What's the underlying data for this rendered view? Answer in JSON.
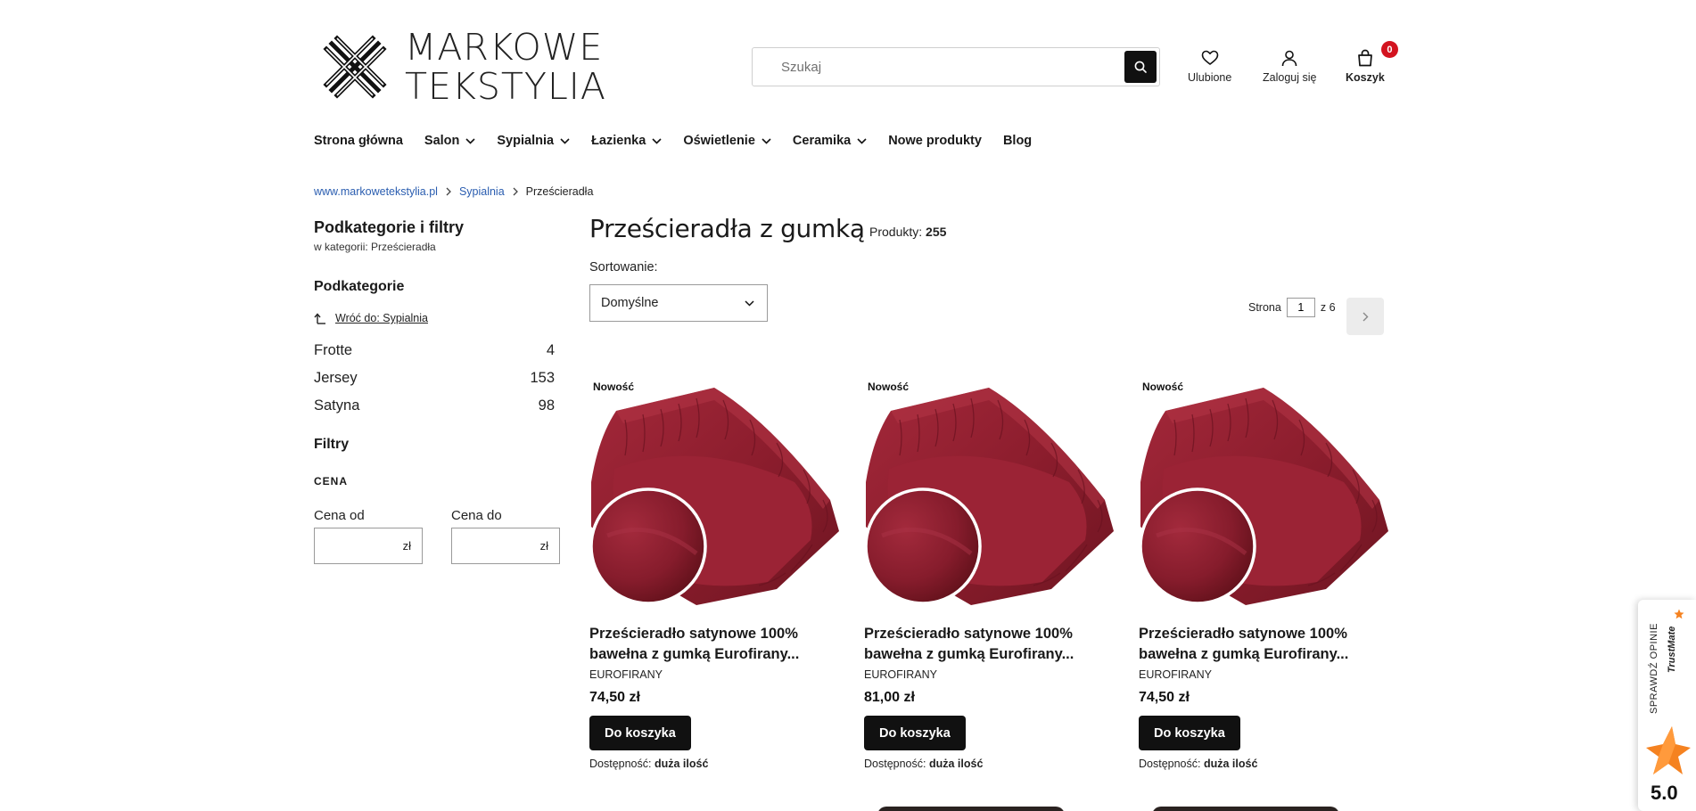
{
  "header": {
    "logo_line1": "MARKOWE",
    "logo_line2": "TEKSTYLIA",
    "search_placeholder": "Szukaj",
    "favorites_label": "Ulubione",
    "login_label": "Zaloguj się",
    "cart_label": "Koszyk",
    "cart_count": "0",
    "accent_color": "#d3131f"
  },
  "nav": {
    "items": [
      {
        "label": "Strona główna",
        "has_dropdown": false
      },
      {
        "label": "Salon",
        "has_dropdown": true
      },
      {
        "label": "Sypialnia",
        "has_dropdown": true
      },
      {
        "label": "Łazienka",
        "has_dropdown": true
      },
      {
        "label": "Oświetlenie",
        "has_dropdown": true
      },
      {
        "label": "Ceramika",
        "has_dropdown": true
      },
      {
        "label": "Nowe produkty",
        "has_dropdown": false
      },
      {
        "label": "Blog",
        "has_dropdown": false
      }
    ]
  },
  "breadcrumb": {
    "home": "www.markowetekstylia.pl",
    "parent": "Sypialnia",
    "current": "Prześcieradła"
  },
  "sidebar": {
    "title": "Podkategorie i filtry",
    "subtitle": "w kategorii: Prześcieradła",
    "subcategories_heading": "Podkategorie",
    "back_link": "Wróć do: Sypialnia",
    "categories": [
      {
        "name": "Frotte",
        "count": "4"
      },
      {
        "name": "Jersey",
        "count": "153"
      },
      {
        "name": "Satyna",
        "count": "98"
      }
    ],
    "filters_heading": "Filtry",
    "price_heading": "CENA",
    "price_from_label": "Cena od",
    "price_to_label": "Cena do",
    "currency": "zł"
  },
  "main": {
    "title": "Prześcieradła z gumką",
    "count_label": "Produkty:",
    "count_value": "255",
    "sort_label": "Sortowanie:",
    "sort_value": "Domyślne",
    "pager_label": "Strona",
    "pager_current": "1",
    "pager_of": "z 6"
  },
  "products": [
    {
      "badge": "Nowość",
      "name_line1": "Prześcieradło satynowe 100%",
      "name_line2": "bawełna z gumką Eurofirany...",
      "brand": "EUROFIRANY",
      "price": "74,50 zł",
      "button": "Do koszyka",
      "availability_label": "Dostępność:",
      "availability_value": "duża ilość",
      "color": "#8e1f2c"
    },
    {
      "badge": "Nowość",
      "name_line1": "Prześcieradło satynowe 100%",
      "name_line2": "bawełna z gumką Eurofirany...",
      "brand": "EUROFIRANY",
      "price": "81,00 zł",
      "button": "Do koszyka",
      "availability_label": "Dostępność:",
      "availability_value": "duża ilość",
      "color": "#8e1f2c"
    },
    {
      "badge": "Nowość",
      "name_line1": "Prześcieradło satynowe 100%",
      "name_line2": "bawełna z gumką Eurofirany...",
      "brand": "EUROFIRANY",
      "price": "74,50 zł",
      "button": "Do koszyka",
      "availability_label": "Dostępność:",
      "availability_value": "duża ilość",
      "color": "#8e1f2c"
    }
  ],
  "trustmate": {
    "label": "SPRAWDŹ OPINIE",
    "brand": "TrustMate",
    "score": "5.0",
    "star_color": "#f58220"
  }
}
